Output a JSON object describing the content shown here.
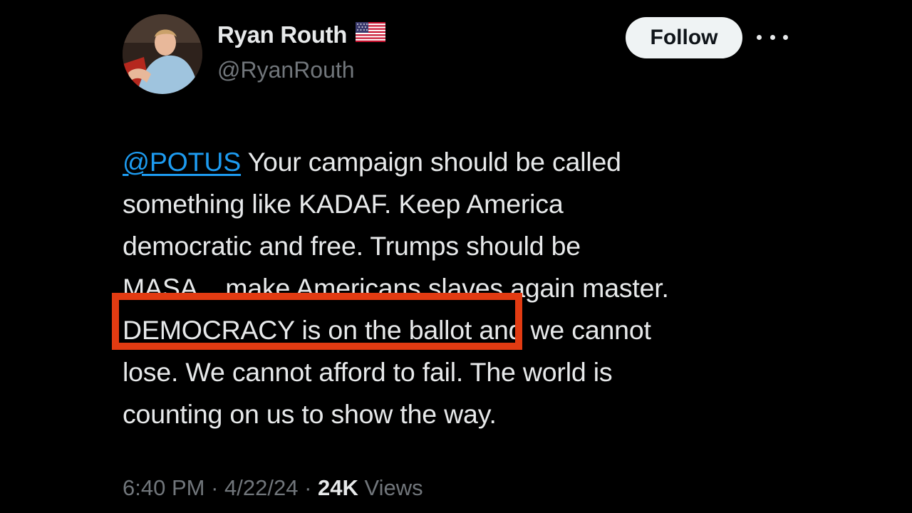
{
  "author": {
    "display_name": "Ryan Routh",
    "flag_icon": "us-flag-icon",
    "handle": "@RyanRouth"
  },
  "actions": {
    "follow_label": "Follow",
    "more_icon": "more-options-icon"
  },
  "tweet": {
    "lines": [
      {
        "mention": "@POTUS",
        "text": " Your campaign should be called"
      },
      {
        "text": "something like KADAF. Keep America"
      },
      {
        "text": "democratic and free. Trumps should be"
      },
      {
        "text": "MASA ...make Americans slaves again master."
      },
      {
        "text": "DEMOCRACY is on the ballot and we cannot"
      },
      {
        "text": "lose. We cannot afford to fail. The world is"
      },
      {
        "text": "counting on us to show the way."
      }
    ],
    "highlighted_phrase": "DEMOCRACY is on the ballot"
  },
  "meta": {
    "time": "6:40 PM",
    "date": "4/22/24",
    "separator": " · ",
    "views_count": "24K",
    "views_label": "Views"
  },
  "colors": {
    "background": "#000000",
    "text": "#e7e9ea",
    "secondary": "#71767b",
    "link": "#1d9bf0",
    "highlight": "#e23b12"
  }
}
